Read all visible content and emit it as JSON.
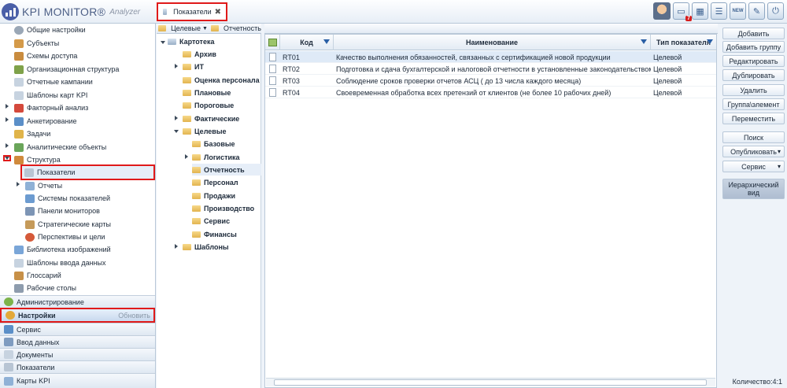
{
  "app": {
    "logo_main": "KPI MONITOR®",
    "logo_sub": "Analyzer"
  },
  "tab": {
    "label": "Показатели"
  },
  "top_icons": [
    "user-avatar",
    "monitor-icon",
    "grid-icon",
    "table-icon",
    "news-icon",
    "pen-icon",
    "power-icon"
  ],
  "notification_count": "7",
  "nav": {
    "items": [
      {
        "label": "Общие настройки",
        "icon": "gear-icon"
      },
      {
        "label": "Субъекты",
        "icon": "users-icon"
      },
      {
        "label": "Схемы доступа",
        "icon": "users-icon"
      },
      {
        "label": "Организационная структура",
        "icon": "org-icon"
      },
      {
        "label": "Отчетные кампании",
        "icon": "doc-icon"
      },
      {
        "label": "Шаблоны карт KPI",
        "icon": "doc-icon"
      },
      {
        "label": "Факторный анализ",
        "icon": "chart-icon"
      },
      {
        "label": "Анкетирование",
        "icon": "form-icon"
      },
      {
        "label": "Задачи",
        "icon": "task-icon"
      },
      {
        "label": "Аналитические объекты",
        "icon": "analytic-icon"
      },
      {
        "label": "Структура",
        "icon": "structure-icon"
      },
      {
        "label": "Показатели",
        "icon": "indicator-icon"
      },
      {
        "label": "Отчеты",
        "icon": "report-icon"
      },
      {
        "label": "Системы показателей",
        "icon": "system-icon"
      },
      {
        "label": "Панели мониторов",
        "icon": "panel-icon"
      },
      {
        "label": "Стратегические карты",
        "icon": "map-icon"
      },
      {
        "label": "Перспективы и цели",
        "icon": "target-icon"
      },
      {
        "label": "Библиотека изображений",
        "icon": "image-icon"
      },
      {
        "label": "Шаблоны ввода данных",
        "icon": "doc-icon"
      },
      {
        "label": "Глоссарий",
        "icon": "book-icon"
      },
      {
        "label": "Рабочие столы",
        "icon": "desk-icon"
      }
    ],
    "sections": [
      {
        "label": "Администрирование"
      },
      {
        "label": "Настройки",
        "action": "Обновить"
      },
      {
        "label": "Сервис"
      },
      {
        "label": "Ввод данных"
      },
      {
        "label": "Документы"
      },
      {
        "label": "Показатели"
      },
      {
        "label": "Карты KPI"
      }
    ]
  },
  "breadcrumb": [
    "Целевые",
    "Отчетность"
  ],
  "tree": [
    "Картотека",
    "Архив",
    "ИТ",
    "Оценка персонала",
    "Плановые",
    "Пороговые",
    "Фактические",
    "Целевые",
    "Базовые",
    "Логистика",
    "Отчетность",
    "Персонал",
    "Продажи",
    "Производство",
    "Сервис",
    "Финансы",
    "Шаблоны"
  ],
  "grid": {
    "columns": [
      "Код",
      "Наименование",
      "Тип показателя"
    ],
    "rows": [
      {
        "code": "RT01",
        "name": "Качество выполнения обязанностей, связанных с сертификацией новой продукции",
        "type": "Целевой"
      },
      {
        "code": "RT02",
        "name": "Подготовка и сдача бухгалтерской и налоговой отчетности в установленные законодательством сроки",
        "type": "Целевой"
      },
      {
        "code": "RT03",
        "name": "Соблюдение сроков проверки отчетов АСЦ  ( до 13 числа каждого месяца)",
        "type": "Целевой"
      },
      {
        "code": "RT04",
        "name": "Своевременная обработка всех претензий от клиентов (не более 10 рабочих дней)",
        "type": "Целевой"
      }
    ]
  },
  "actions": {
    "add": "Добавить",
    "add_group": "Добавить группу",
    "edit": "Редактировать",
    "duplicate": "Дублировать",
    "delete": "Удалить",
    "group_element": "Группа\\элемент",
    "move": "Переместить",
    "search": "Поиск",
    "publish": "Опубликовать",
    "service": "Сервис",
    "hier_view_1": "Иерархический",
    "hier_view_2": "вид"
  },
  "status": {
    "count": "Количество:4:1"
  }
}
